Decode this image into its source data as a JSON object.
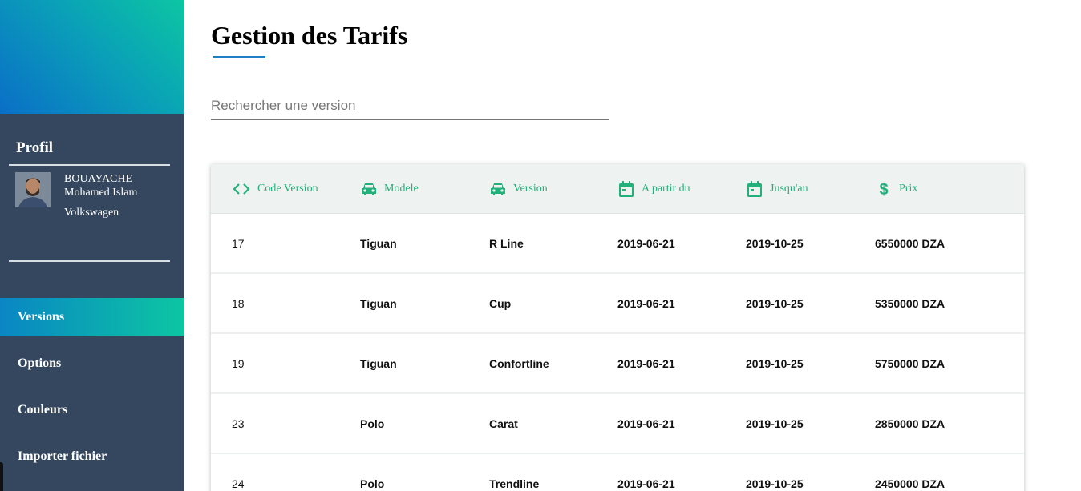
{
  "sidebar": {
    "profile_title": "Profil",
    "user": {
      "last_name": "BOUAYACHE",
      "first_name": "Mohamed Islam",
      "brand": "Volkswagen"
    },
    "nav": [
      {
        "label": "Versions",
        "active": true
      },
      {
        "label": "Options",
        "active": false
      },
      {
        "label": "Couleurs",
        "active": false
      },
      {
        "label": "Importer fichier",
        "active": false
      }
    ]
  },
  "main": {
    "title": "Gestion des Tarifs",
    "search_placeholder": "Rechercher une version",
    "table": {
      "columns": [
        {
          "label": "Code Version",
          "icon": "code-icon"
        },
        {
          "label": "Modele",
          "icon": "car-icon"
        },
        {
          "label": "Version",
          "icon": "car-icon"
        },
        {
          "label": "A partir du",
          "icon": "calendar-icon"
        },
        {
          "label": "Jusqu'au",
          "icon": "calendar-icon"
        },
        {
          "label": "Prix",
          "icon": "dollar-icon"
        }
      ],
      "rows": [
        {
          "code": "17",
          "modele": "Tiguan",
          "version": "R Line",
          "from": "2019-06-21",
          "to": "2019-10-25",
          "price": "6550000 DZA"
        },
        {
          "code": "18",
          "modele": "Tiguan",
          "version": "Cup",
          "from": "2019-06-21",
          "to": "2019-10-25",
          "price": "5350000 DZA"
        },
        {
          "code": "19",
          "modele": "Tiguan",
          "version": "Confortline",
          "from": "2019-06-21",
          "to": "2019-10-25",
          "price": "5750000 DZA"
        },
        {
          "code": "23",
          "modele": "Polo",
          "version": "Carat",
          "from": "2019-06-21",
          "to": "2019-10-25",
          "price": "2850000 DZA"
        },
        {
          "code": "24",
          "modele": "Polo",
          "version": "Trendline",
          "from": "2019-06-21",
          "to": "2019-10-25",
          "price": "2450000 DZA"
        }
      ]
    }
  },
  "colors": {
    "accent_green": "#23b07a",
    "sidebar_bg": "#34475f",
    "gradient_start": "#0a6fc7",
    "gradient_end": "#0cc6a2"
  }
}
